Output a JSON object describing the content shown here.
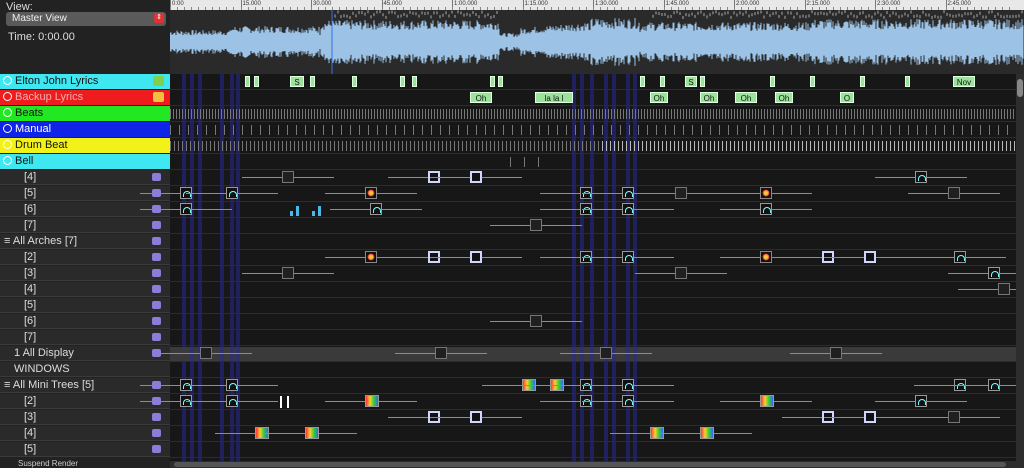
{
  "view": {
    "label": "View:",
    "selected": "Master View",
    "arrows_icon": "updown-arrows-icon"
  },
  "time": {
    "label": "Time: 0:00.00"
  },
  "ruler": {
    "ticks": [
      "0:00",
      "15.000",
      "30.000",
      "45.000",
      "1:00.000",
      "1:15.000",
      "1:30.000",
      "1:45.000",
      "2:00.000",
      "2:15.000",
      "2:30.000",
      "2:45.000"
    ]
  },
  "timing_tracks": [
    {
      "name": "Elton John Lyrics",
      "color": "#3fe8f0",
      "text_color": "#111111"
    },
    {
      "name": "Backup Lyrics",
      "color": "#ee1c1c",
      "text_color": "#f0b0b0"
    },
    {
      "name": "Beats",
      "color": "#22e822",
      "text_color": "#111111"
    },
    {
      "name": "Manual",
      "color": "#1024e8",
      "text_color": "#ffffff"
    },
    {
      "name": "Drum Beat",
      "color": "#f2f21a",
      "text_color": "#111111"
    },
    {
      "name": "Bell",
      "color": "#3fe8f0",
      "text_color": "#111111"
    }
  ],
  "models": [
    {
      "label": "[4]"
    },
    {
      "label": "[5]"
    },
    {
      "label": "[6]"
    },
    {
      "label": "[7]"
    },
    {
      "label": "All Arches [7]"
    },
    {
      "label": "[2]"
    },
    {
      "label": "[3]"
    },
    {
      "label": "[4]"
    },
    {
      "label": "[5]"
    },
    {
      "label": "[6]"
    },
    {
      "label": "[7]"
    },
    {
      "label": "1 All Display"
    },
    {
      "label": "WINDOWS"
    },
    {
      "label": "All Mini Trees [5]"
    },
    {
      "label": "[2]"
    },
    {
      "label": "[3]"
    },
    {
      "label": "[4]"
    },
    {
      "label": "[5]"
    }
  ],
  "lyrics_elton": [
    "S",
    "S",
    "Nov"
  ],
  "lyrics_backup": [
    "Oh",
    "la la l",
    "Oh",
    "Oh",
    "Oh",
    "Oh",
    "O"
  ],
  "status": {
    "suspend": "Suspend Render"
  }
}
